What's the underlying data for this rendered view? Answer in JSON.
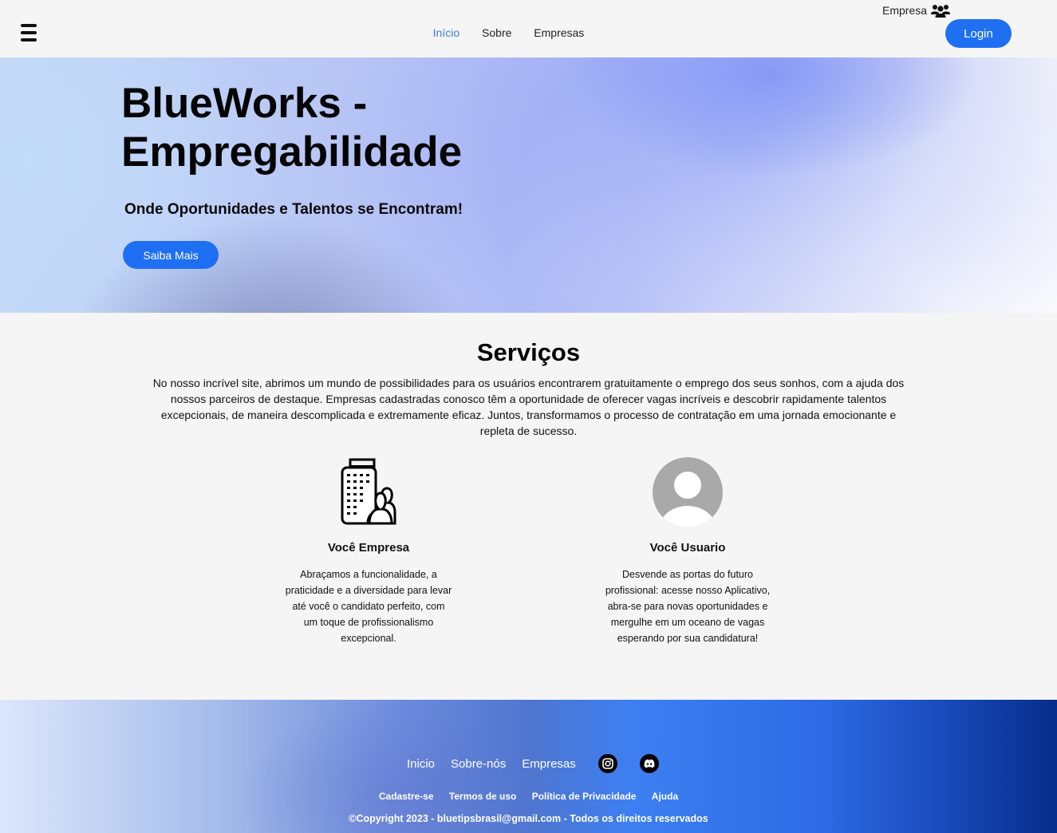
{
  "header": {
    "nav": {
      "inicio": "Início",
      "sobre": "Sobre",
      "empresas": "Empresas"
    },
    "empresa_label": "Empresa",
    "login_label": "Login"
  },
  "hero": {
    "title": "BlueWorks - Empregabilidade",
    "subtitle": "Onde Oportunidades e Talentos se Encontram!",
    "button_label": "Saiba Mais"
  },
  "services": {
    "title": "Serviços",
    "description": "No nosso incrível site, abrimos um mundo de possibilidades para os usuários encontrarem gratuitamente o emprego dos seus sonhos, com a ajuda dos nossos parceiros de destaque. Empresas cadastradas conosco têm a oportunidade de oferecer vagas incríveis e descobrir rapidamente talentos excepcionais, de maneira descomplicada e extremamente eficaz. Juntos, transformamos o processo de contratação em uma jornada emocionante e repleta de sucesso.",
    "cards": [
      {
        "icon": "building-people-icon",
        "title": "Você Empresa",
        "text": "Abraçamos a funcionalidade, a praticidade e a diversidade para levar até você o candidato perfeito, com um toque de profissionalismo excepcional."
      },
      {
        "icon": "user-avatar-icon",
        "title": "Você Usuario",
        "text": "Desvende as portas do futuro profissional: acesse nosso Aplicativo, abra-se para novas oportunidades e mergulhe em um oceano de vagas esperando por sua candidatura!"
      }
    ]
  },
  "footer": {
    "nav": {
      "inicio": "Inicio",
      "sobre": "Sobre-nós",
      "empresas": "Empresas"
    },
    "social": [
      "instagram-icon",
      "discord-icon"
    ],
    "links": {
      "cadastre": "Cadastre-se",
      "termos": "Termos de uso",
      "politica": "Política de Privacidade",
      "ajuda": "Ajuda"
    },
    "copyright": "©Copyright 2023 - bluetipsbrasil@gmail.com - Todos os direitos reservados"
  },
  "colors": {
    "accent": "#1f6ff2",
    "nav_active": "#3b7be8",
    "background": "#f5f5f5"
  }
}
